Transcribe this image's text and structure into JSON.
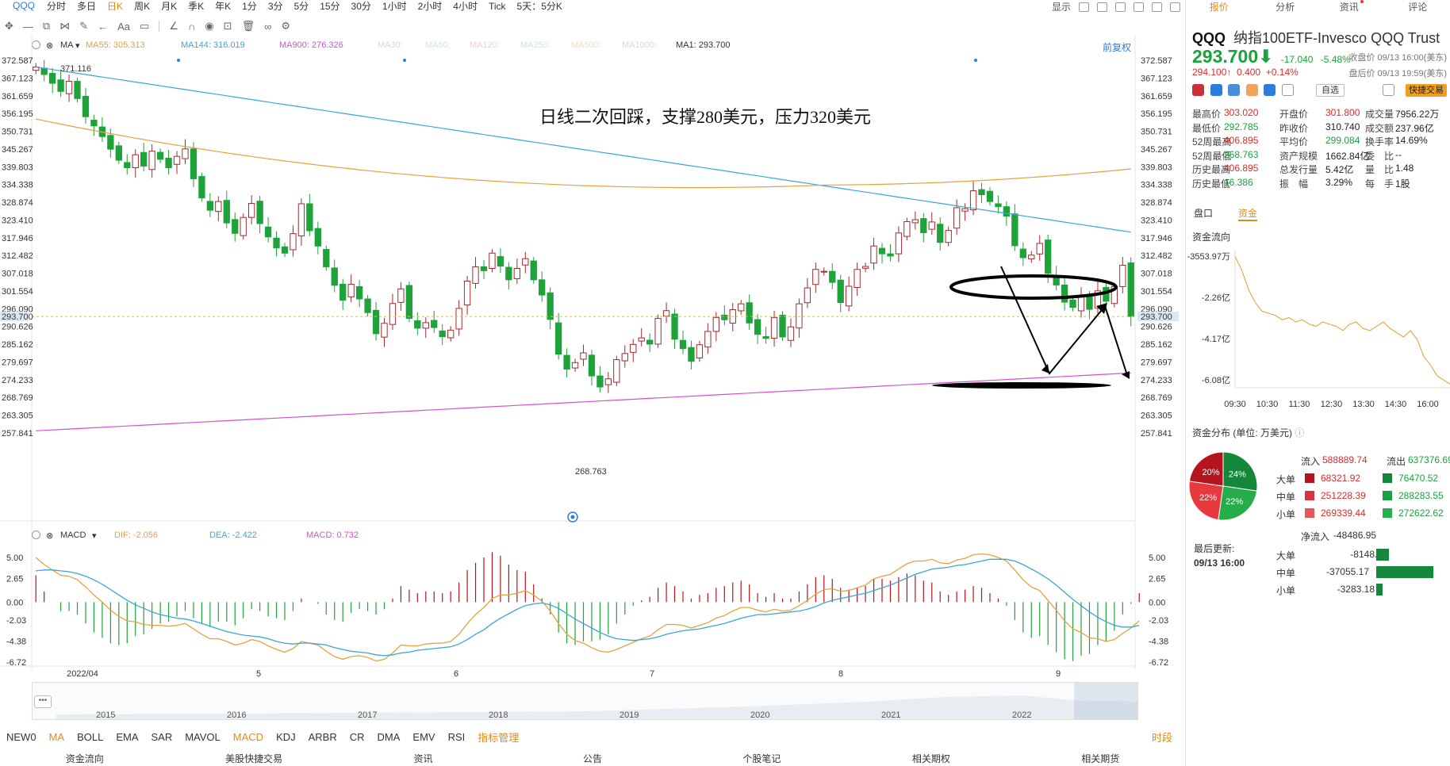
{
  "topbar": {
    "symbol": "QQQ",
    "periods": [
      "分时",
      "多日",
      "日K",
      "周K",
      "月K",
      "季K",
      "年K",
      "1分",
      "3分",
      "5分",
      "15分",
      "30分",
      "1小时",
      "2小时",
      "4小时",
      "Tick",
      "5天：5分K"
    ],
    "active_period": "日K",
    "display_label": "显示"
  },
  "ma_legend": {
    "label": "MA",
    "items": [
      {
        "text": "MA55: 305.313",
        "color": "#e8a13d"
      },
      {
        "text": "MA144: 316.019",
        "color": "#3aa6d8"
      },
      {
        "text": "MA900: 276.326",
        "color": "#d54fd0"
      },
      {
        "text": "MA30:",
        "color": "#cfd8e6"
      },
      {
        "text": "MA60:",
        "color": "#cfe6e6"
      },
      {
        "text": "MA120:",
        "color": "#f3cfd2"
      },
      {
        "text": "MA250:",
        "color": "#c9e3f0"
      },
      {
        "text": "MA500:",
        "color": "#f2dcc0"
      },
      {
        "text": "MA1000:",
        "color": "#e3cfe8"
      },
      {
        "text": "MA1: 293.700",
        "color": "#333333"
      }
    ],
    "fuquan": "前复权"
  },
  "annotation": "日线二次回踩，支撑280美元，压力320美元",
  "chart_data": [
    {
      "type": "candlestick",
      "title": "",
      "y_ticks": [
        "372.587",
        "367.123",
        "361.659",
        "356.195",
        "350.731",
        "345.267",
        "339.803",
        "334.338",
        "328.874",
        "323.410",
        "317.946",
        "312.482",
        "307.018",
        "301.554",
        "296.090",
        "290.626",
        "285.162",
        "279.697",
        "274.233",
        "268.769",
        "263.305",
        "257.841"
      ],
      "ylim": [
        257.841,
        372.587
      ],
      "x_labels": [
        "2022/04",
        "5",
        "6",
        "7",
        "8",
        "9"
      ],
      "current_price_label": "293.700",
      "max_label": "371.116",
      "min_label": "268.763",
      "closes": [
        370.5,
        368.2,
        365.5,
        363.0,
        366.1,
        360.8,
        355.2,
        352.4,
        349.1,
        345.2,
        341.8,
        339.5,
        343.5,
        340.0,
        344.6,
        342.1,
        339.5,
        343.0,
        345.3,
        336.1,
        330.2,
        326.4,
        329.1,
        322.5,
        319.3,
        324.2,
        328.5,
        322.3,
        318.2,
        314.8,
        313.2,
        319.2,
        328.4,
        320.1,
        315.4,
        309.0,
        303.3,
        298.7,
        303.6,
        299.1,
        294.9,
        288.4,
        291.6,
        297.7,
        302.2,
        293.1,
        290.1,
        291.8,
        290.3,
        287.5,
        289.5,
        296.2,
        304.6,
        309.0,
        307.8,
        313.2,
        309.2,
        305.0,
        308.5,
        311.5,
        305.0,
        300.3,
        292.8,
        282.1,
        277.5,
        279.5,
        282.5,
        275.4,
        272.0,
        274.5,
        280.4,
        282.3,
        285.1,
        287.1,
        285.2,
        293.1,
        295.5,
        286.7,
        283.8,
        279.9,
        285.0,
        289.1,
        293.4,
        292.7,
        295.8,
        297.6,
        291.7,
        288.2,
        287.0,
        293.4,
        287.4,
        290.5,
        297.6,
        302.5,
        308.2,
        307.6,
        304.2,
        298.0,
        303.0,
        308.2,
        309.1,
        315.4,
        313.0,
        312.3,
        319.4,
        322.9,
        323.5,
        319.5,
        322.8,
        316.5,
        320.2,
        327.2,
        326.9,
        332.4,
        331.2,
        329.1,
        327.5,
        324.6,
        315.5,
        311.8,
        312.6,
        316.2,
        307.0,
        303.4,
        298.1,
        296.5,
        300.2,
        295.9,
        301.6,
        298.4,
        302.9,
        309.5,
        293.7
      ]
    },
    {
      "type": "macd",
      "legend": {
        "label": "MACD",
        "dif": "DIF: -2.056",
        "dea": "DEA: -2.422",
        "macd": "MACD: 0.732"
      },
      "y_ticks": [
        "5.00",
        "2.65",
        "0.00",
        "-2.03",
        "-4.38",
        "-6.72"
      ],
      "ylim": [
        -6.72,
        5.0
      ],
      "dif": [
        5.0,
        4.2,
        3.6,
        3.0,
        2.9,
        2.5,
        1.7,
        0.8,
        0.0,
        -0.9,
        -1.6,
        -2.1,
        -2.2,
        -2.5,
        -2.6,
        -2.6,
        -2.7,
        -2.6,
        -2.4,
        -3.0,
        -3.6,
        -4.1,
        -4.1,
        -4.4,
        -4.8,
        -4.6,
        -4.2,
        -4.4,
        -4.9,
        -5.3,
        -5.6,
        -5.2,
        -4.4,
        -4.6,
        -4.8,
        -5.5,
        -6.1,
        -6.4,
        -6.1,
        -6.0,
        -6.2,
        -6.6,
        -6.4,
        -5.7,
        -4.8,
        -4.9,
        -4.9,
        -4.7,
        -4.6,
        -4.6,
        -4.4,
        -3.6,
        -2.4,
        -1.4,
        -0.6,
        0.4,
        0.8,
        0.8,
        1.0,
        1.3,
        0.8,
        0.1,
        -1.0,
        -2.4,
        -3.6,
        -4.3,
        -4.6,
        -5.1,
        -5.5,
        -5.6,
        -5.3,
        -4.9,
        -4.5,
        -4.1,
        -3.8,
        -3.1,
        -2.5,
        -2.5,
        -2.6,
        -2.9,
        -2.6,
        -2.3,
        -1.8,
        -1.5,
        -1.0,
        -0.6,
        -0.6,
        -0.9,
        -1.1,
        -0.8,
        -1.0,
        -0.9,
        -0.4,
        0.2,
        0.9,
        1.4,
        1.5,
        1.2,
        1.3,
        1.6,
        1.9,
        2.6,
        2.9,
        3.1,
        3.7,
        4.3,
        4.6,
        4.6,
        4.8,
        4.4,
        4.3,
        4.7,
        4.9,
        5.3,
        5.4,
        5.3,
        5.0,
        4.6,
        3.6,
        2.5,
        1.7,
        1.3,
        0.2,
        -0.9,
        -2.1,
        -3.0,
        -3.4,
        -4.0,
        -4.1,
        -4.4,
        -4.2,
        -3.5,
        -2.9,
        -2.1
      ],
      "dea": [
        3.5,
        3.6,
        3.6,
        3.5,
        3.4,
        3.2,
        2.9,
        2.5,
        2.0,
        1.4,
        0.8,
        0.2,
        -0.3,
        -0.7,
        -1.1,
        -1.4,
        -1.6,
        -1.8,
        -1.9,
        -2.1,
        -2.4,
        -2.7,
        -3.0,
        -3.3,
        -3.5,
        -3.7,
        -3.8,
        -3.9,
        -4.1,
        -4.4,
        -4.6,
        -4.7,
        -4.6,
        -4.6,
        -4.7,
        -4.8,
        -5.1,
        -5.3,
        -5.5,
        -5.6,
        -5.7,
        -5.9,
        -6.0,
        -5.9,
        -5.7,
        -5.6,
        -5.4,
        -5.3,
        -5.2,
        -5.1,
        -5.0,
        -4.7,
        -4.2,
        -3.6,
        -3.1,
        -2.4,
        -1.8,
        -1.3,
        -0.8,
        -0.4,
        -0.2,
        -0.1,
        -0.3,
        -0.7,
        -1.3,
        -1.9,
        -2.4,
        -2.9,
        -3.4,
        -3.8,
        -4.1,
        -4.2,
        -4.3,
        -4.2,
        -4.1,
        -3.9,
        -3.6,
        -3.4,
        -3.2,
        -3.1,
        -3.0,
        -2.8,
        -2.6,
        -2.4,
        -2.1,
        -1.8,
        -1.6,
        -1.4,
        -1.4,
        -1.3,
        -1.2,
        -1.1,
        -1.0,
        -0.8,
        -0.5,
        -0.1,
        0.2,
        0.4,
        0.6,
        0.8,
        1.0,
        1.3,
        1.6,
        1.9,
        2.3,
        2.7,
        3.1,
        3.4,
        3.7,
        3.8,
        3.9,
        4.1,
        4.2,
        4.4,
        4.6,
        4.8,
        4.8,
        4.8,
        4.6,
        4.2,
        3.7,
        3.2,
        2.6,
        1.9,
        1.1,
        0.3,
        -0.4,
        -1.1,
        -1.7,
        -2.2,
        -2.6,
        -2.8,
        -2.8,
        -2.6
      ]
    }
  ],
  "navigator": {
    "years": [
      "2015",
      "2016",
      "2017",
      "2018",
      "2019",
      "2020",
      "2021",
      "2022"
    ],
    "dots": "•••"
  },
  "indicator_tabs": {
    "items": [
      "NEW0",
      "MA",
      "BOLL",
      "EMA",
      "SAR",
      "MAVOL",
      "MACD",
      "KDJ",
      "ARBR",
      "CR",
      "DMA",
      "EMV",
      "RSI",
      "指标管理"
    ],
    "right": "时段"
  },
  "bottom_tabs": [
    "资金流向",
    "美股快捷交易",
    "资讯",
    "公告",
    "个股笔记",
    "相关期权",
    "相关期货"
  ],
  "right_panel": {
    "tabs": [
      "报价",
      "分析",
      "资讯",
      "评论"
    ],
    "symbol": "QQQ",
    "name": "纳指100ETF-Invesco QQQ Trust",
    "price": "293.700",
    "arrow": "⬇",
    "change": "-17.040",
    "change_pct": "-5.48%",
    "close_time": "收盘价 09/13 16:00(美东)",
    "post_price": "294.100↑",
    "post_change": "0.400",
    "post_pct": "+0.14%",
    "post_time": "盘后价 09/13 19:59(美东)",
    "zixuan": "自选",
    "quick_trade": "快捷交易",
    "stats": [
      [
        {
          "l": "最高价",
          "v": "303.020",
          "c": "red"
        },
        {
          "l": "开盘价",
          "v": "301.800",
          "c": "red"
        },
        {
          "l": "成交量",
          "v": "7956.22万",
          "c": "blk"
        }
      ],
      [
        {
          "l": "最低价",
          "v": "292.785",
          "c": "green"
        },
        {
          "l": "昨收价",
          "v": "310.740",
          "c": "blk"
        },
        {
          "l": "成交额",
          "v": "237.96亿",
          "c": "blk"
        }
      ],
      [
        {
          "l": "52周最高",
          "v": "406.895",
          "c": "red"
        },
        {
          "l": "平均价",
          "v": "299.084",
          "c": "green"
        },
        {
          "l": "换手率",
          "v": "14.69%",
          "c": "blk"
        }
      ],
      [
        {
          "l": "52周最低",
          "v": "268.763",
          "c": "green"
        },
        {
          "l": "资产规模",
          "v": "1662.84亿",
          "c": "blk"
        },
        {
          "l": "委　比",
          "v": "--",
          "c": "blk"
        }
      ],
      [
        {
          "l": "历史最高",
          "v": "406.895",
          "c": "red"
        },
        {
          "l": "总发行量",
          "v": "5.42亿",
          "c": "blk"
        },
        {
          "l": "量　比",
          "v": "1.48",
          "c": "blk"
        }
      ],
      [
        {
          "l": "历史最低",
          "v": "16.386",
          "c": "green"
        },
        {
          "l": "振　幅",
          "v": "3.29%",
          "c": "blk"
        },
        {
          "l": "每　手",
          "v": "1股",
          "c": "blk"
        }
      ]
    ],
    "subtabs": [
      "盘口",
      "资金"
    ],
    "flow_title": "资金流向",
    "flow_chart": {
      "type": "line",
      "y_ticks": [
        "-3553.97万",
        "-2.26亿",
        "-4.17亿",
        "-6.08亿"
      ],
      "x_ticks": [
        "09:30",
        "10:30",
        "11:30",
        "12:30",
        "13:30",
        "14:30",
        "16:00"
      ],
      "values": [
        -0.36,
        -1.0,
        -1.9,
        -2.5,
        -2.9,
        -3.0,
        -3.1,
        -3.3,
        -3.2,
        -3.4,
        -3.3,
        -3.5,
        -3.6,
        -3.4,
        -3.5,
        -3.6,
        -3.8,
        -3.5,
        -3.4,
        -3.7,
        -3.8,
        -3.6,
        -3.4,
        -3.7,
        -3.9,
        -4.1,
        -3.8,
        -4.2,
        -5.0,
        -5.4,
        -5.9,
        -6.1,
        -6.3
      ]
    },
    "dist_title": "资金分布 (单位: 万美元)",
    "pie": [
      {
        "label": "20%",
        "color": "#b5141c"
      },
      {
        "label": "24%",
        "color": "#14873a"
      },
      {
        "label": "22%",
        "color": "#e8393f"
      },
      {
        "label": "22%",
        "color": "#25ad4a"
      }
    ],
    "inflow_label": "流入",
    "inflow_total": "588889.74",
    "outflow_label": "流出",
    "outflow_total": "637376.69",
    "dist_rows": [
      {
        "label": "大单",
        "in": "68321.92",
        "out": "76470.52"
      },
      {
        "label": "中单",
        "in": "251228.39",
        "out": "288283.55"
      },
      {
        "label": "小单",
        "in": "269339.44",
        "out": "272622.62"
      }
    ],
    "last_update_label": "最后更新:",
    "last_update": "09/13 16:00",
    "net_label": "净流入",
    "net_total": "-48486.95",
    "net_rows": [
      {
        "label": "大单",
        "value": "-8148.6",
        "amount": -8148.6
      },
      {
        "label": "中单",
        "value": "-37055.17",
        "amount": -37055.17
      },
      {
        "label": "小单",
        "value": "-3283.18",
        "amount": -3283.18
      }
    ]
  }
}
